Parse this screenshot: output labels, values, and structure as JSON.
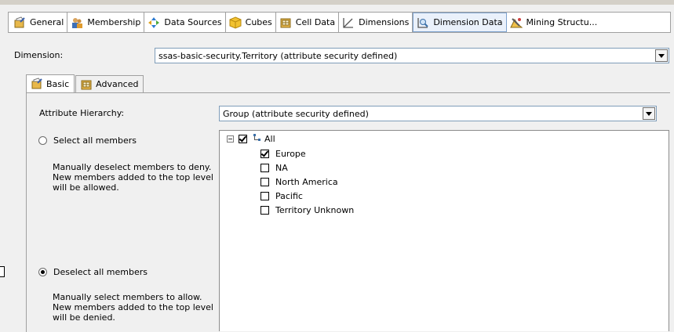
{
  "tabs": [
    {
      "label": "General",
      "icon": "general-icon"
    },
    {
      "label": "Membership",
      "icon": "membership-icon"
    },
    {
      "label": "Data Sources",
      "icon": "data-sources-icon"
    },
    {
      "label": "Cubes",
      "icon": "cubes-icon"
    },
    {
      "label": "Cell Data",
      "icon": "cell-data-icon"
    },
    {
      "label": "Dimensions",
      "icon": "dimensions-icon"
    },
    {
      "label": "Dimension Data",
      "icon": "dimension-data-icon",
      "selected": true
    },
    {
      "label": "Mining Structu...",
      "icon": "mining-structures-icon"
    }
  ],
  "dimension": {
    "label": "Dimension:",
    "value": "ssas-basic-security.Territory (attribute security defined)"
  },
  "subtabs": [
    {
      "label": "Basic",
      "active": true
    },
    {
      "label": "Advanced",
      "active": false
    }
  ],
  "attribute_hierarchy": {
    "label": "Attribute Hierarchy:",
    "value": "Group (attribute security defined)"
  },
  "select_all": {
    "label": "Select all members",
    "selected": false,
    "description": "Manually deselect members to deny. New members added to the top level will be allowed."
  },
  "deselect_all": {
    "label": "Deselect all members",
    "selected": true,
    "description": "Manually select members to allow. New members added to the top level will be denied."
  },
  "tree": {
    "root": {
      "label": "All",
      "checked": true
    },
    "members": [
      {
        "label": "Europe",
        "checked": true
      },
      {
        "label": "NA",
        "checked": false
      },
      {
        "label": "North America",
        "checked": false
      },
      {
        "label": "Pacific",
        "checked": false
      },
      {
        "label": "Territory Unknown",
        "checked": false
      }
    ]
  }
}
